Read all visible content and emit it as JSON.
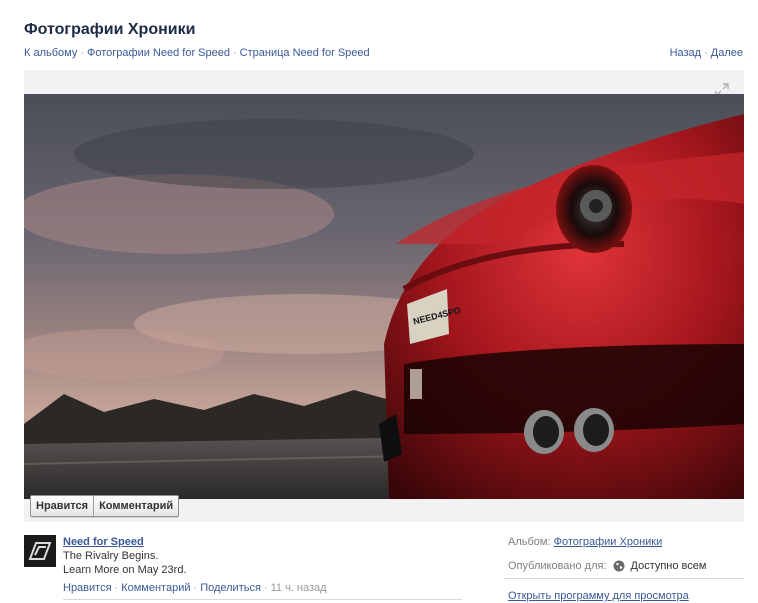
{
  "page": {
    "title": "Фотографии Хроники"
  },
  "breadcrumb": {
    "items": [
      "К альбому",
      "Фотографии Need for Speed",
      "Страница Need for Speed"
    ],
    "separator": "·"
  },
  "pager": {
    "prev": "Назад",
    "next": "Далее",
    "separator": "·"
  },
  "photo": {
    "actions": {
      "like": "Нравится",
      "comment": "Комментарий"
    },
    "plate_text": "NEED4SPD",
    "expand_icon": "expand-icon"
  },
  "post": {
    "owner": "Need for Speed",
    "caption_line1": "The Rivalry Begins.",
    "caption_line2": "Learn More on May 23rd.",
    "actions": {
      "like": "Нравится",
      "comment": "Комментарий",
      "share": "Поделиться"
    },
    "separator": "·",
    "time": "11 ч. назад",
    "avatar_icon": "nfs-logo-icon"
  },
  "side": {
    "album_label": "Альбом:",
    "album_name": "Фотографии Хроники",
    "published_label": "Опубликовано для:",
    "privacy_value": "Доступно всем",
    "privacy_icon": "globe-icon",
    "viewer_link": "Открыть программу для просмотра"
  },
  "colors": {
    "link": "#3b5998",
    "title": "#1c2a47",
    "car": "#b31b1b"
  }
}
